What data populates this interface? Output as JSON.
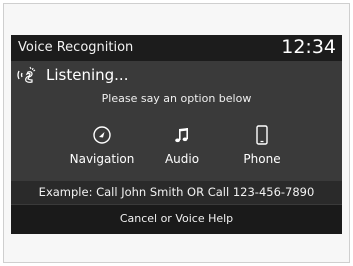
{
  "header": {
    "title": "Voice Recognition",
    "time": "12:34"
  },
  "status": {
    "text": "Listening...",
    "icon": "voice-command-icon"
  },
  "prompt": "Please say an option below",
  "options": [
    {
      "label": "Navigation",
      "icon": "navigation-icon"
    },
    {
      "label": "Audio",
      "icon": "music-note-icon"
    },
    {
      "label": "Phone",
      "icon": "phone-icon"
    }
  ],
  "example": "Example: Call John Smith OR Call 123-456-7890",
  "footer": {
    "cancel_label": "Cancel or Voice Help"
  }
}
